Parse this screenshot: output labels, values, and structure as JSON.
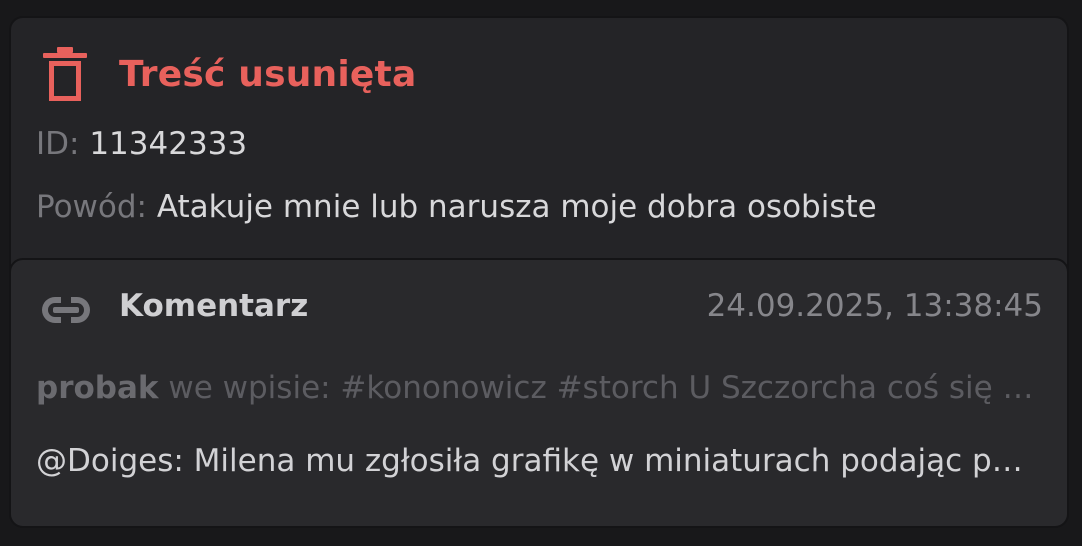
{
  "header": {
    "title": "Treść usunięta",
    "icon": "trash-icon",
    "accent_color": "#e8615c"
  },
  "meta": {
    "id_label": "ID:",
    "id_value": "11342333",
    "reason_label": "Powód:",
    "reason_value": "Atakuje mnie lub narusza moje dobra osobiste"
  },
  "item": {
    "icon": "link-icon",
    "kind": "Komentarz",
    "timestamp": "24.09.2025, 13:38:45",
    "author": "probak",
    "context": "we wpisie: #kononowicz #storch U Szczorcha coś się dzieje",
    "comment": "@Doiges: Milena mu zgłosiła grafikę w miniaturach podając powód"
  }
}
